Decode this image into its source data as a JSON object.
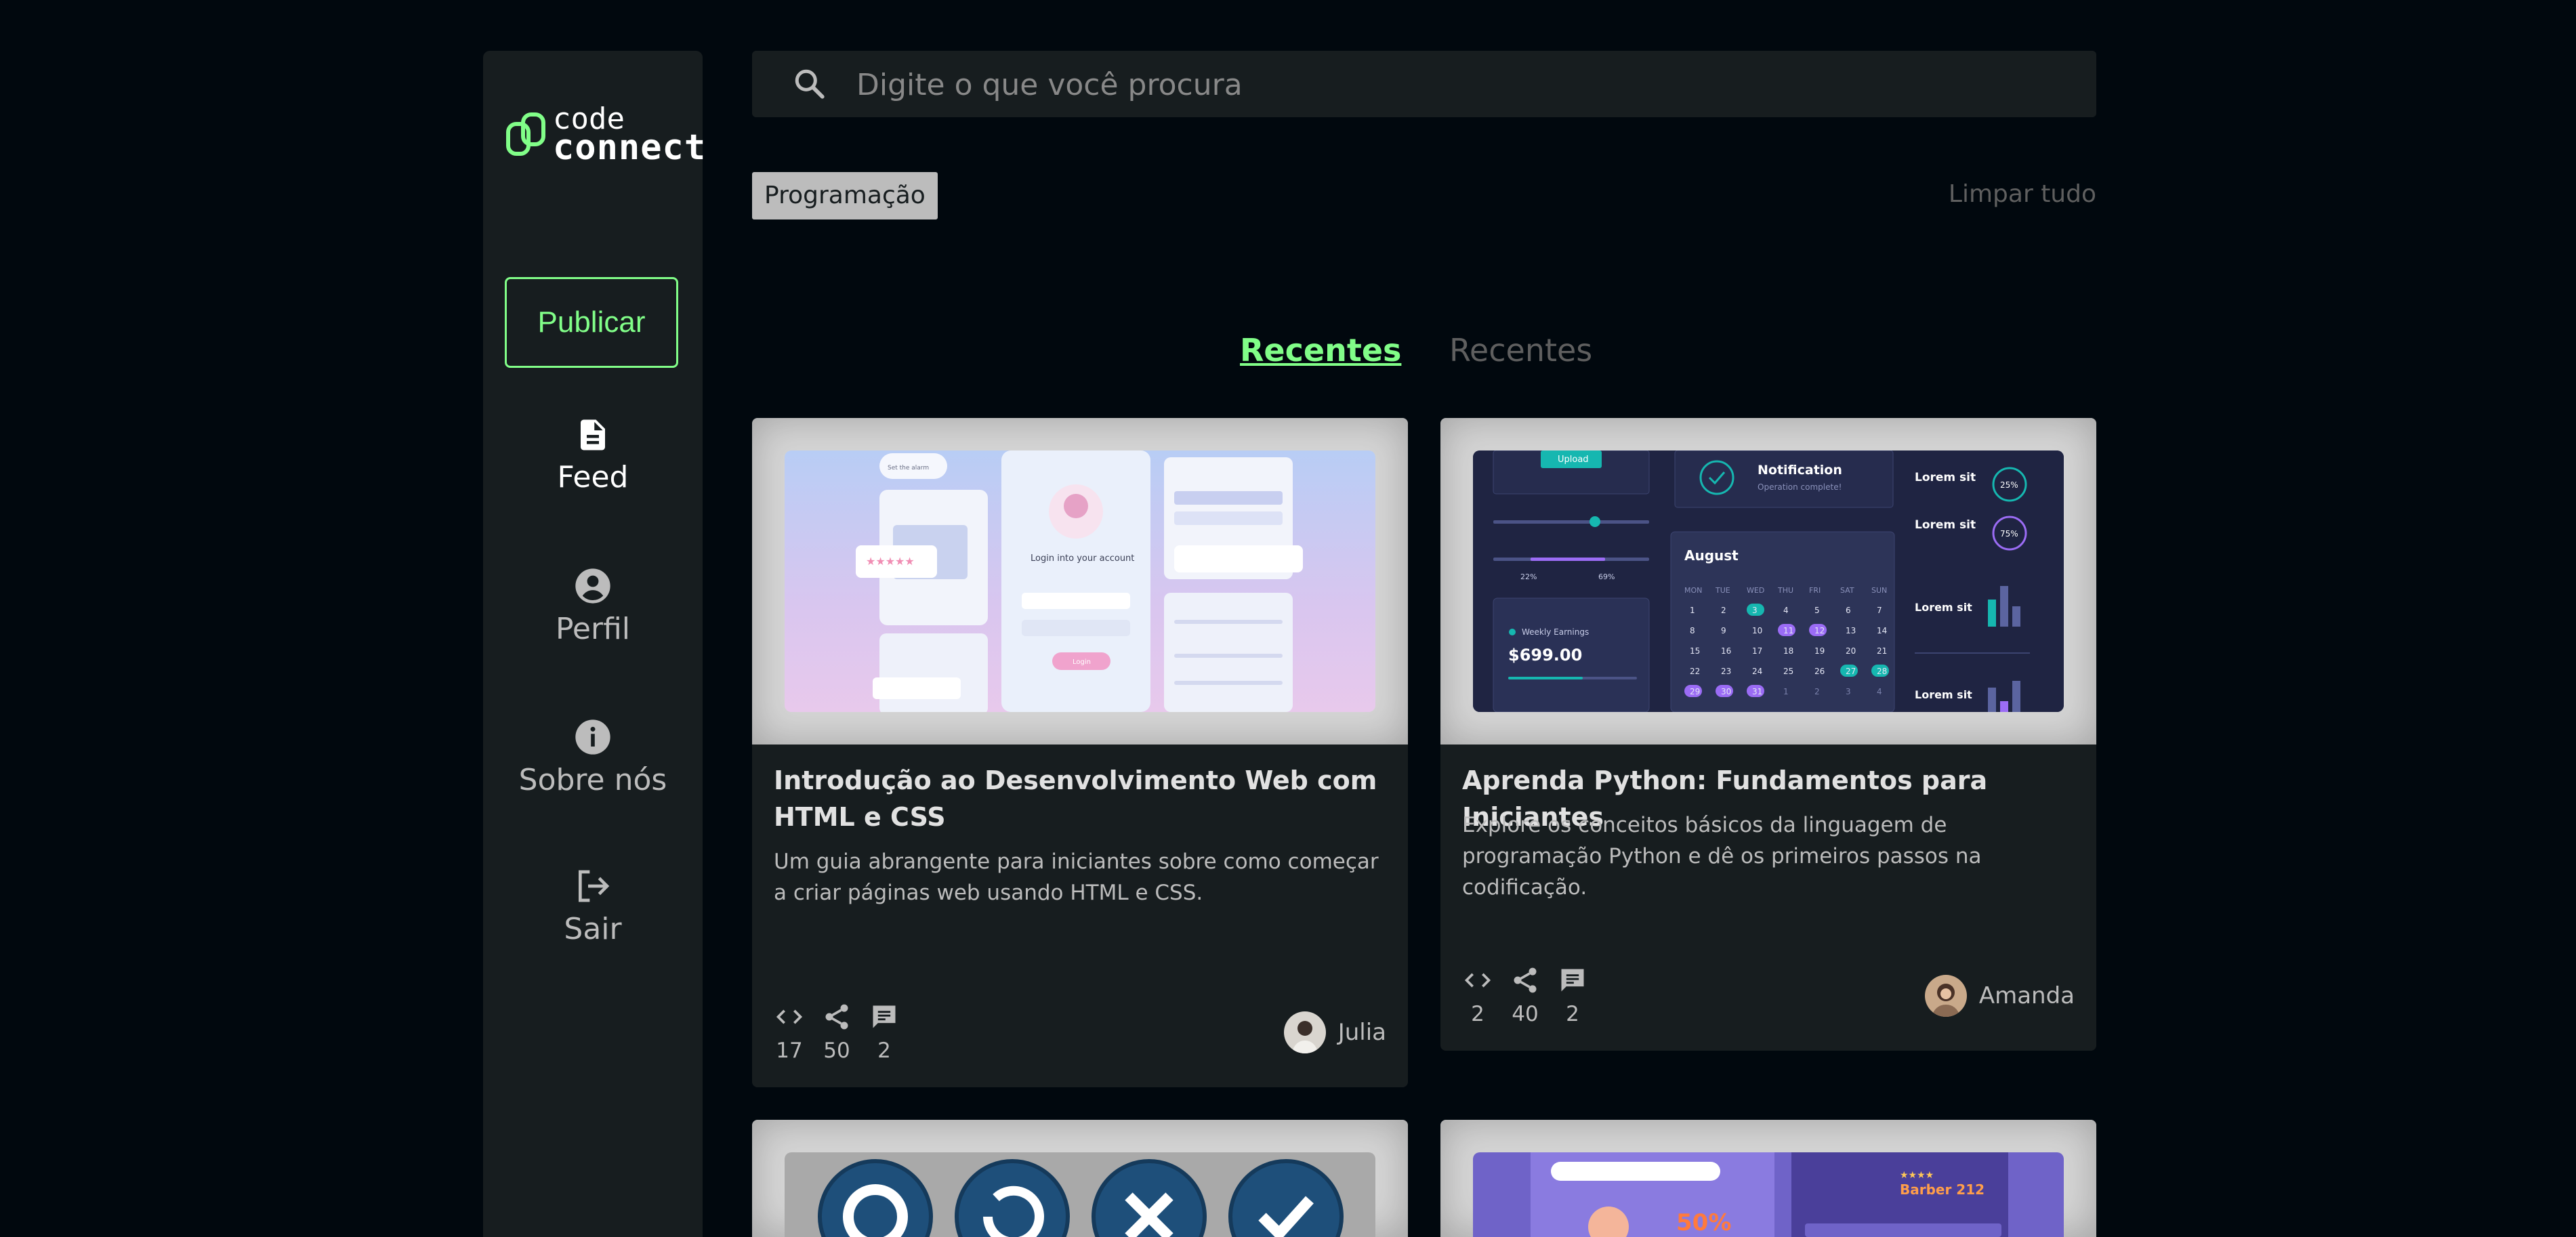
{
  "sidebar": {
    "logo": {
      "line1": "code",
      "line2": "connect"
    },
    "publish_label": "Publicar",
    "nav": [
      {
        "label": "Feed",
        "icon": "document-icon"
      },
      {
        "label": "Perfil",
        "icon": "user-icon"
      },
      {
        "label": "Sobre nós",
        "icon": "info-icon"
      },
      {
        "label": "Sair",
        "icon": "logout-icon"
      }
    ]
  },
  "search": {
    "placeholder": "Digite o que você procura",
    "value": ""
  },
  "filters": {
    "tag": "Programação",
    "clear_label": "Limpar tudo"
  },
  "tabs": [
    {
      "label": "Recentes",
      "active": true
    },
    {
      "label": "Recentes",
      "active": false
    }
  ],
  "colors": {
    "background": "#01080e",
    "panel": "#171d1f",
    "accent": "#81fe88",
    "text": "#e1e1e1",
    "muted": "#bcbcbc",
    "dim": "#5f5f5f"
  },
  "posts": [
    {
      "title": "Introdução ao Desenvolvimento Web com HTML e CSS",
      "description": "Um guia abrangente para iniciantes sobre como começar a criar páginas web usando HTML e CSS.",
      "stats": {
        "code": "17",
        "share": "50",
        "comments": "2"
      },
      "author": "Julia"
    },
    {
      "title": "Aprenda Python: Fundamentos para Iniciantes",
      "description": "Explore os conceitos básicos da linguagem de programação Python e dê os primeiros passos na codificação.",
      "stats": {
        "code": "2",
        "share": "40",
        "comments": "2"
      },
      "author": "Amanda"
    }
  ],
  "thumbnail_text": {
    "login": {
      "title": "Login into your account",
      "button": "Login",
      "filter": "Set the alarm"
    },
    "dashboard": {
      "upload": "Upload",
      "notification": "Notification",
      "notification_sub": "Operation complete!",
      "month": "August",
      "earnings_label": "Weekly Earnings",
      "earnings_value": "$699.00",
      "pct_low": "22%",
      "pct_high": "69%",
      "ring1": "25%",
      "ring2": "75%",
      "lorem": "Lorem sit",
      "weekdays": [
        "MON",
        "TUE",
        "WED",
        "THU",
        "FRI",
        "SAT",
        "SUN"
      ]
    },
    "barber": {
      "name": "Barber 212",
      "promo": "50%"
    }
  }
}
